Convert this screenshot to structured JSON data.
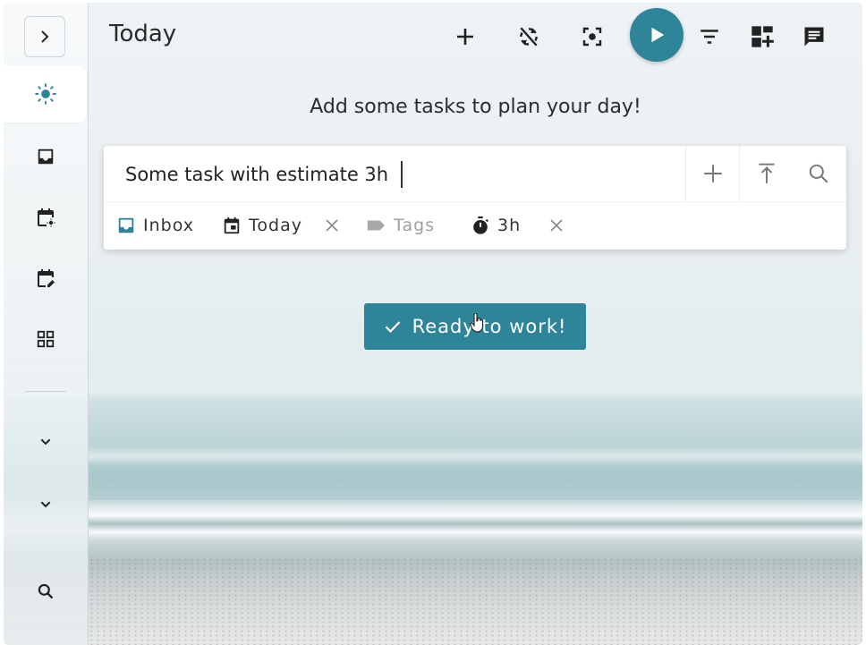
{
  "header": {
    "title": "Today"
  },
  "hint": "Add some tasks to plan your day!",
  "add_task": {
    "input_value": "Some task with estimate 3h",
    "project_chip": "Inbox",
    "due_chip": "Today",
    "tags_chip": "Tags",
    "estimate_chip": "3h"
  },
  "ready_button": {
    "label": "Ready to work!"
  },
  "colors": {
    "accent": "#2e8599",
    "inbox_icon": "#2e8599"
  },
  "icons": {
    "sidebar": [
      "chevron-right-icon",
      "sun-icon",
      "inbox-icon",
      "calendar-today-icon",
      "calendar-edit-icon",
      "grid-icon",
      "chevron-down-icon",
      "chevron-down-icon",
      "search-icon"
    ],
    "header": [
      "plus-icon",
      "sync-off-icon",
      "focus-icon",
      "play-icon",
      "filter-icon",
      "add-board-icon",
      "chat-icon"
    ]
  }
}
